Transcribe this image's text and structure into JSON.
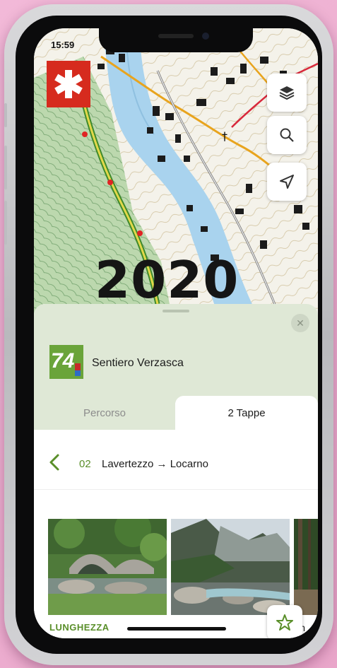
{
  "status": {
    "time": "15:59"
  },
  "overlay": {
    "year": "2020"
  },
  "route": {
    "number": "74",
    "title": "Sentiero Verzasca"
  },
  "tabs": [
    {
      "label": "Percorso",
      "active": false
    },
    {
      "label": "2 Tappe",
      "active": true
    }
  ],
  "stage": {
    "number": "02",
    "name": "Lavertezzo → Locarno"
  },
  "details": {
    "length_label": "LUNGHEZZA",
    "length_value": "21km"
  },
  "icons": {
    "logo": "swiss-star-logo",
    "layers": "layers-icon",
    "search": "search-icon",
    "locate": "location-arrow-icon",
    "close": "close-icon",
    "back": "chevron-left-icon",
    "favorite": "star-icon"
  },
  "colors": {
    "accent_green": "#5a8f2a",
    "sheet_green": "#dfe8d6",
    "logo_red": "#d62b1e",
    "route_green": "#6aa43a"
  }
}
